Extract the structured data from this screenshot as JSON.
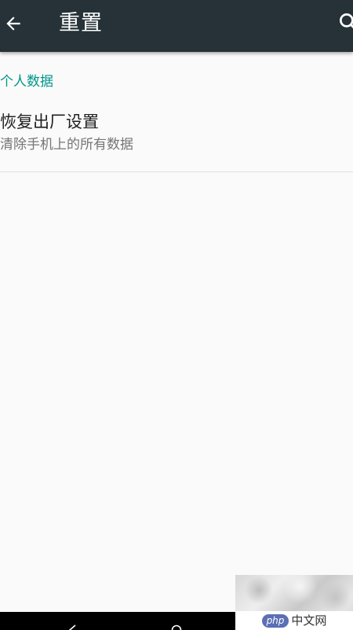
{
  "app_bar": {
    "title": "重置",
    "back_icon": "arrow-left-icon",
    "search_icon": "search-icon",
    "background_color": "#263238"
  },
  "sections": [
    {
      "header": "个人数据",
      "header_color": "#009688",
      "items": [
        {
          "title": "恢复出厂设置",
          "summary": "清除手机上的所有数据"
        }
      ]
    }
  ],
  "watermark": {
    "logo_badge": "php",
    "logo_text": "中文网"
  },
  "nav_bar": {
    "back_icon": "nav-back-icon",
    "home_icon": "nav-home-icon"
  }
}
